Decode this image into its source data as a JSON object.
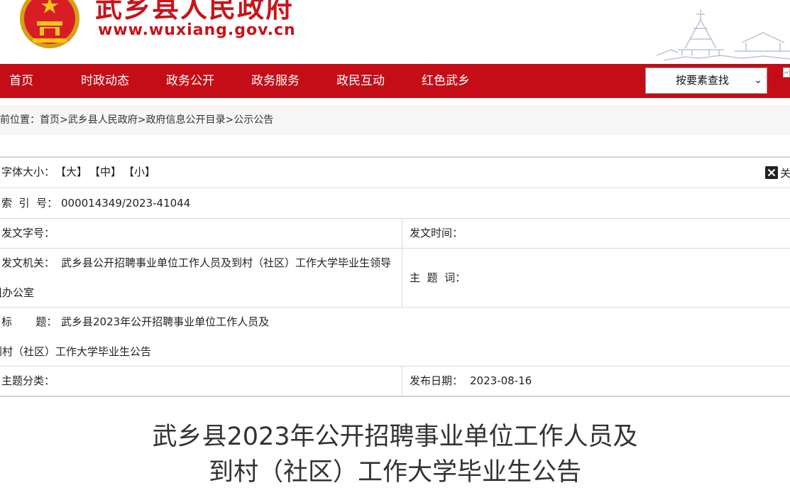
{
  "header": {
    "site_name": "武乡县人民政府",
    "site_url": "www.wuxiang.gov.cn",
    "emblem_icon": "national-emblem-icon",
    "brand_color": "#c8141a"
  },
  "nav": {
    "items": [
      {
        "label": "首页"
      },
      {
        "label": "时政动态"
      },
      {
        "label": "政务公开"
      },
      {
        "label": "政务服务"
      },
      {
        "label": "政民互动"
      },
      {
        "label": "红色武乡"
      }
    ],
    "search_select": {
      "value": "按要素查找",
      "arrow_icon": "chevron-down-icon"
    },
    "color": "#c40d16"
  },
  "breadcrumb": {
    "prefix": "前位置：",
    "items": [
      "首页",
      "武乡县人民政府",
      "政府信息公开目录",
      "公示公告"
    ],
    "separator": ">"
  },
  "toolbar": {
    "font_size_label": "字体大小：",
    "options": [
      "【大】",
      "【中】",
      "【小】"
    ],
    "close_label": "关",
    "close_icon": "close-icon"
  },
  "info": {
    "index_label": "索  引  号：",
    "index_value": "000014349/2023-41044",
    "doc_no_label": "发文字号：",
    "doc_no_value": "",
    "doc_time_label": "发文时间：",
    "doc_time_value": "",
    "issuer_label": "发文机关：",
    "issuer_value_line1": "武乡县公开招聘事业单位工作人员及到村（社区）工作大学毕业生领导",
    "issuer_value_line2": "组办公室",
    "keywords_label": "主  题  词：",
    "keywords_value": "",
    "title_label": "标       题：",
    "title_value_line1": "武乡县2023年公开招聘事业单位工作人员及",
    "title_value_line2": "到村（社区）工作大学毕业生公告",
    "category_label": "主题分类：",
    "category_value": "",
    "publish_label": "发布日期：",
    "publish_value": "2023-08-16"
  },
  "document": {
    "title_line1": "武乡县2023年公开招聘事业单位工作人员及",
    "title_line2": "到村（社区）工作大学毕业生公告"
  }
}
